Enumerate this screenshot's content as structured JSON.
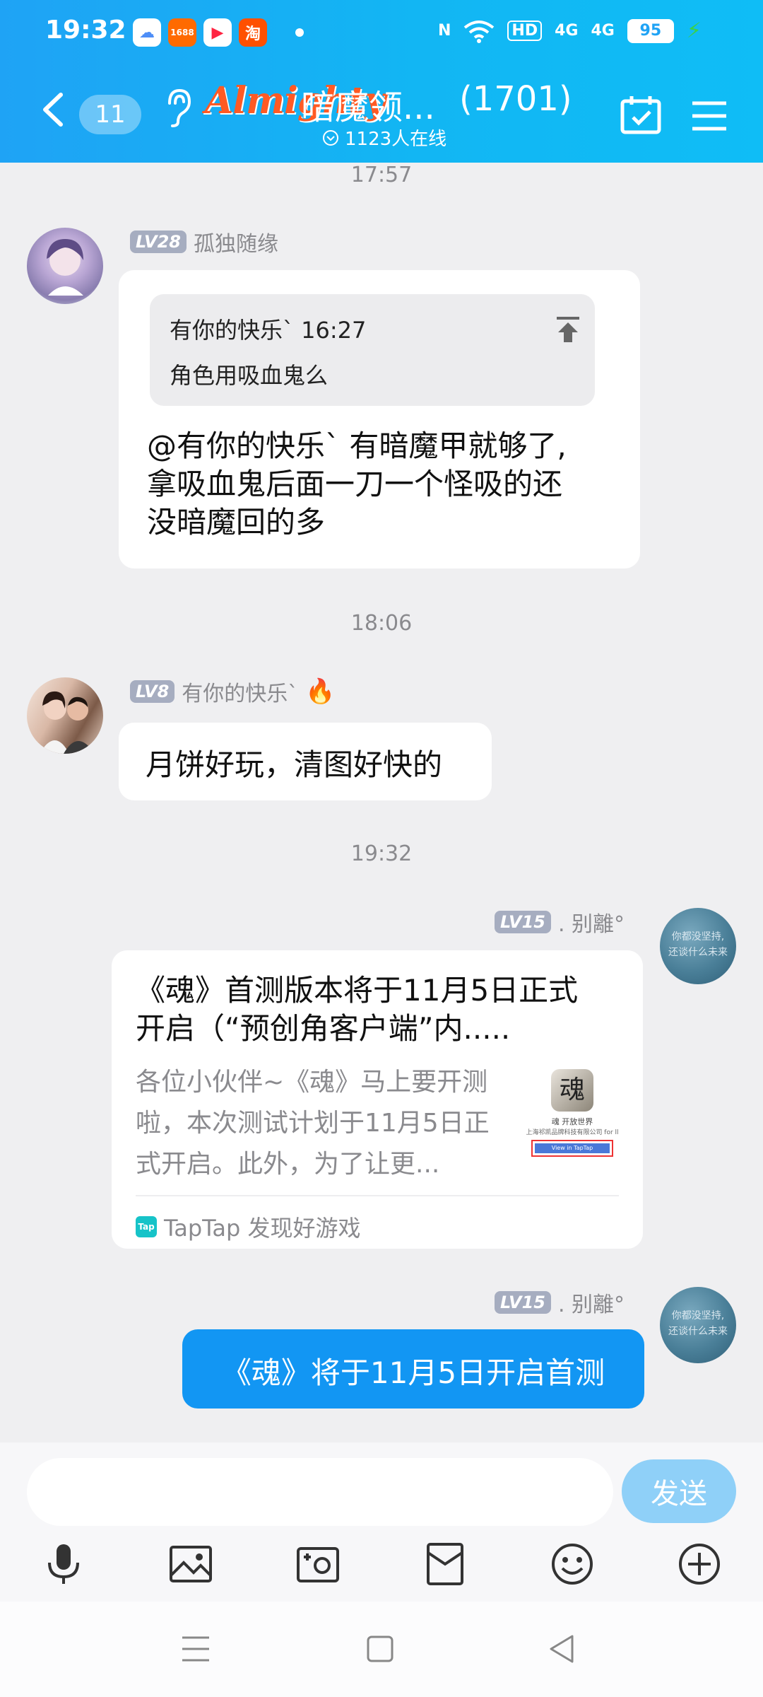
{
  "status_bar": {
    "time": "19:32",
    "app_icons": [
      {
        "name": "baidu-netdisk-icon",
        "color": "#4e8ef7",
        "glyph": "☁"
      },
      {
        "name": "alibaba-icon",
        "color": "#ff6a00",
        "glyph": "1688"
      },
      {
        "name": "video-app-icon",
        "color": "#ff2442",
        "glyph": "▶"
      },
      {
        "name": "taobao-icon",
        "color": "#ff5000",
        "glyph": "淘"
      }
    ],
    "hd_label": "HD",
    "signal_label_1": "4G",
    "signal_label_2": "4G",
    "battery": "95"
  },
  "header": {
    "unread_count": "11",
    "logo_text": "Almighty",
    "title": "暗魔领...",
    "member_count": "(1701)",
    "online": "1123人在线"
  },
  "chat": {
    "time_1": "17:57",
    "msg1": {
      "level": "LV28",
      "nickname": "孤独随缘",
      "quote_author": "有你的快乐` 16:27",
      "quote_text": "角色用吸血鬼么",
      "text_line1": "@有你的快乐` 有暗魔甲就够了,",
      "text_line2": "拿吸血鬼后面一刀一个怪吸的还",
      "text_line3": "没暗魔回的多"
    },
    "time_2": "18:06",
    "msg2": {
      "level": "LV8",
      "nickname": "有你的快乐`",
      "text": "月饼好玩，清图好快的"
    },
    "time_3": "19:32",
    "msg3": {
      "level": "LV15",
      "nickname": ". 别離°",
      "avatar_text_1": "你都没坚持,",
      "avatar_text_2": "还谈什么未来",
      "card_title_line1": "《魂》首测版本将于11月5日正式",
      "card_title_line2": "开启（“预创角客户端”内.....",
      "card_desc_line1": "各位小伙伴~《魂》马上要开测",
      "card_desc_line2": "啦，本次测试计划于11月5日正",
      "card_desc_line3": "式开启。此外，为了让更...",
      "thumb_caption": "魂 开放世界",
      "thumb_company": "上海祁凯品牌科技有限公司 for ll",
      "thumb_button": "View in TapTap",
      "source_badge": "Tap",
      "source_text": "TapTap 发现好游戏"
    },
    "msg4": {
      "level": "LV15",
      "nickname": ". 别離°",
      "text": "《魂》将于11月5日开启首测"
    }
  },
  "composer": {
    "send_label": "发送"
  },
  "colors": {
    "header": "#1fa3f5",
    "own_bubble": "#1296f3",
    "send_button": "#8fd0f8"
  }
}
